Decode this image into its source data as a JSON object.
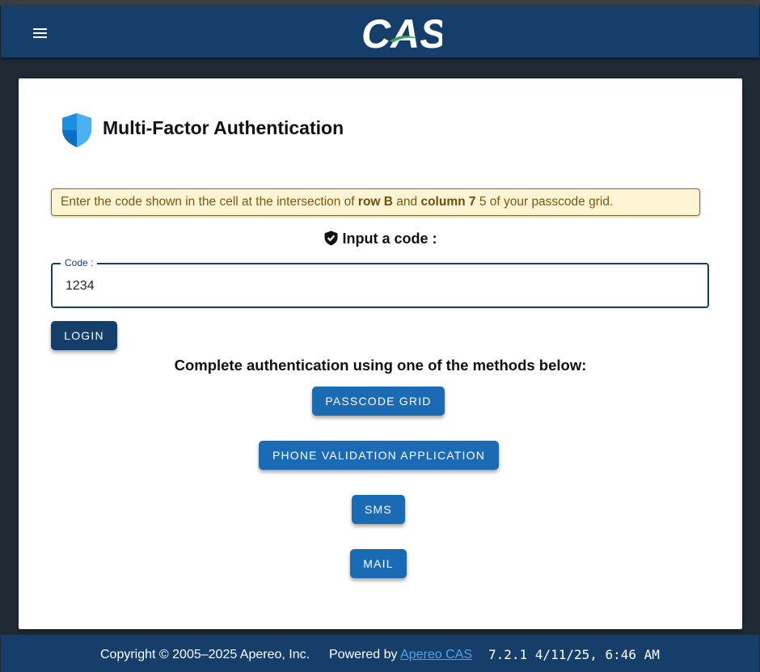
{
  "header": {
    "logo_text": "CAS",
    "menu_icon": "menu-icon"
  },
  "card": {
    "title": "Multi-Factor Authentication",
    "title_icon": "shield-icon",
    "notice": {
      "before": "Enter the code shown in the cell at the intersection of ",
      "row": "row B",
      "middle": " and ",
      "column": "column 7",
      "after": " 5 of your passcode grid."
    },
    "input_heading": "Input a code :",
    "input_heading_icon": "shield-check-icon",
    "code_field": {
      "label": "Code :",
      "value": "1234"
    },
    "login_label": "LOGIN",
    "methods_heading": "Complete authentication using one of the methods below:",
    "methods": [
      {
        "label": "PASSCODE GRID"
      },
      {
        "label": "PHONE VALIDATION APPLICATION"
      },
      {
        "label": "SMS"
      },
      {
        "label": "MAIL"
      }
    ]
  },
  "footer": {
    "copyright": "Copyright © 2005–2025 Apereo, Inc.",
    "powered_prefix": "Powered by ",
    "powered_link": "Apereo CAS",
    "version": "7.2.1 4/11/25, 6:46 AM"
  },
  "colors": {
    "header_bg": "#153e6b",
    "page_bg": "#1f2a35",
    "method_button": "#1b6ab4",
    "notice_bg": "#fff4d4",
    "link": "#4ea3f0"
  }
}
